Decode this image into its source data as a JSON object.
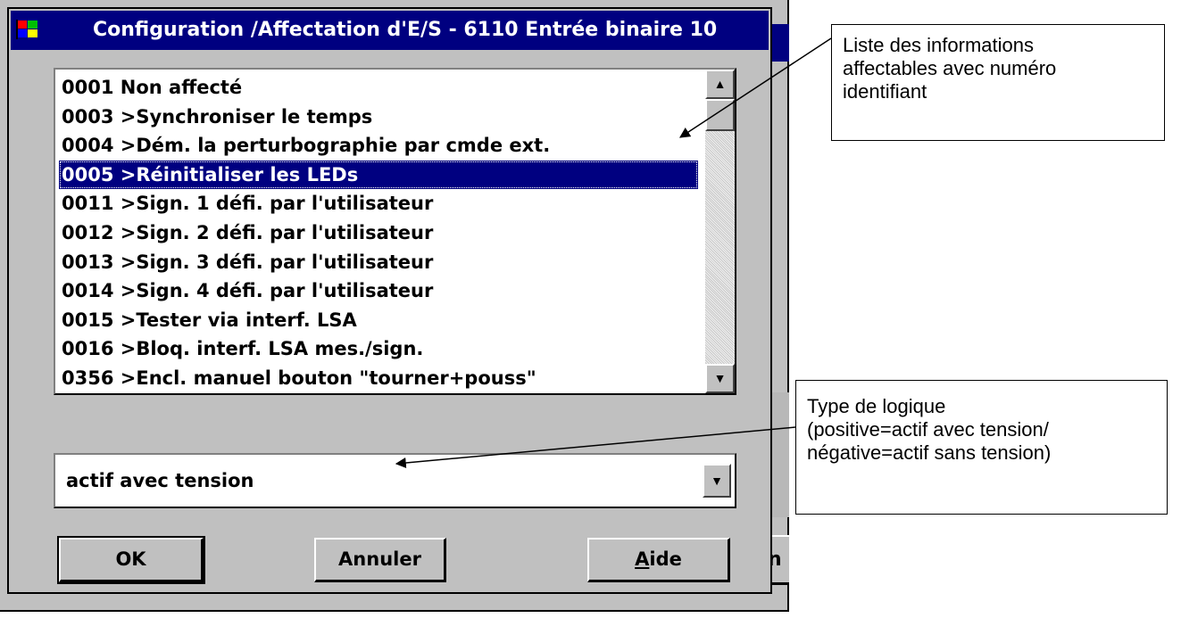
{
  "dialog": {
    "title": "Configuration /Affectation d'E/S - 6110 Entrée binaire 10",
    "list": {
      "items": [
        "0001 Non affecté",
        "0003 >Synchroniser le temps",
        "0004 >Dém. la perturbographie par cmde ext.",
        "0005 >Réinitialiser les LEDs",
        "0011 >Sign. 1 défi. par l'utilisateur",
        "0012 >Sign. 2 défi. par l'utilisateur",
        "0013 >Sign. 3 défi. par l'utilisateur",
        "0014 >Sign. 4 défi. par l'utilisateur",
        "0015 >Tester via interf. LSA",
        "0016 >Bloq. interf. LSA mes./sign.",
        "0356 >Encl. manuel bouton \"tourner+pouss\""
      ],
      "selected": "0005 >Réinitialiser les LEDs"
    },
    "logic_select": {
      "value": "actif avec tension"
    },
    "buttons": {
      "ok": "OK",
      "cancel": "Annuler",
      "help_accesskey": "A",
      "help_rest": "ide"
    }
  },
  "background": {
    "button_fragment": "n"
  },
  "callouts": {
    "list_info": {
      "lines": [
        "Liste des informations",
        "affectables avec numéro",
        "identifiant"
      ]
    },
    "logic_type": {
      "lines": [
        "Type de logique",
        "(positive=actif avec tension/",
        "négative=actif sans tension)"
      ]
    }
  },
  "icons": {
    "system_menu": "windows-flag-icon",
    "scroll_up": "arrow-up-icon",
    "scroll_down": "arrow-down-icon",
    "combo": "dropdown-arrow-icon"
  },
  "colors": {
    "titlebar": "#000080",
    "window": "#c0c0c0",
    "selection": "#000080"
  }
}
